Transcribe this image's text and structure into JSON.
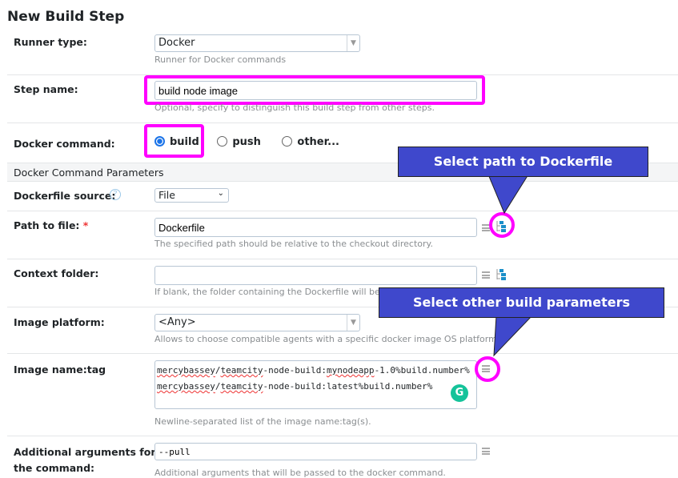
{
  "title": "New Build Step",
  "runner_type": {
    "label": "Runner type:",
    "value": "Docker",
    "note": "Runner for Docker commands"
  },
  "step_name": {
    "label": "Step name:",
    "value": "build node image",
    "note": "Optional, specify to distinguish this build step from other steps."
  },
  "docker_command": {
    "label": "Docker command:",
    "options": [
      "build",
      "push",
      "other..."
    ],
    "selected": "build"
  },
  "section_header": "Docker Command Parameters",
  "dockerfile_source": {
    "label": "Dockerfile source:",
    "value": "File"
  },
  "path_to_file": {
    "label": "Path to file:",
    "required": "*",
    "value": "Dockerfile",
    "note": "The specified path should be relative to the checkout directory."
  },
  "context_folder": {
    "label": "Context folder:",
    "value": "",
    "note": "If blank, the folder containing the Dockerfile will be u"
  },
  "image_platform": {
    "label": "Image platform:",
    "value": "<Any>",
    "note": "Allows to choose compatible agents with a specific docker image OS platform."
  },
  "image_name_tag": {
    "label": "Image name:tag",
    "lines": [
      {
        "user": "mercybassey",
        "slash": "/",
        "repo": "teamcity",
        "rest1": "-node-build:",
        "tag": "mynodeapp",
        "rest2": "-1.0%build.number%"
      },
      {
        "user": "mercybassey",
        "slash": "/",
        "repo": "teamcity",
        "rest1": "-node-build:latest%build.number%"
      }
    ],
    "note": "Newline-separated list of the image name:tag(s)."
  },
  "additional_args": {
    "label1": "Additional arguments for",
    "label2": "the command:",
    "value": "--pull",
    "note": "Additional arguments that will be passed to the docker command."
  },
  "callouts": {
    "path": "Select path to Dockerfile",
    "params": "Select other build parameters"
  },
  "colors": {
    "callout": "#3f48cc",
    "highlight": "#ff00ff",
    "accent": "#1a73e8"
  }
}
